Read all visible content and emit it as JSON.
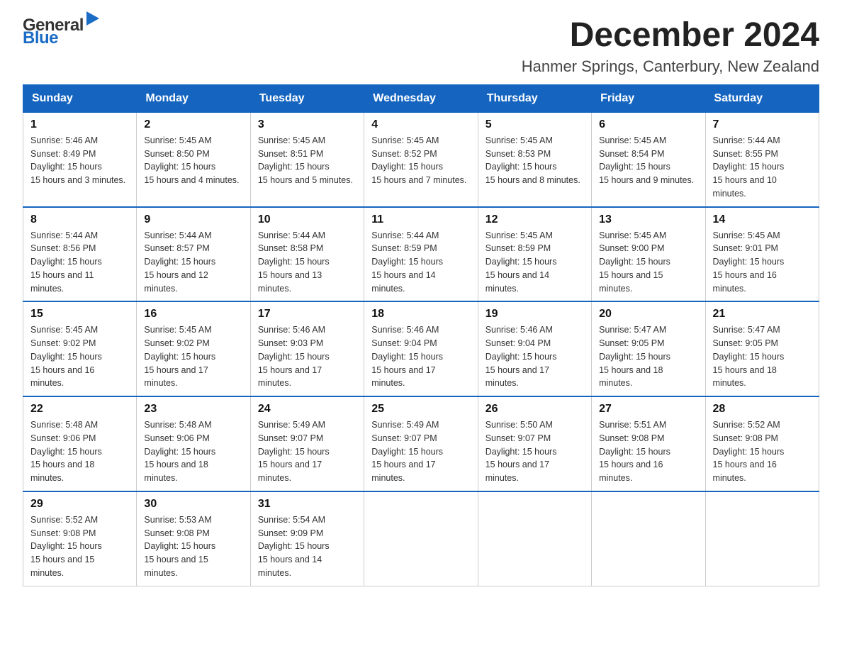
{
  "header": {
    "logo_general": "General",
    "logo_blue": "Blue",
    "title": "December 2024",
    "subtitle": "Hanmer Springs, Canterbury, New Zealand"
  },
  "calendar": {
    "days_of_week": [
      "Sunday",
      "Monday",
      "Tuesday",
      "Wednesday",
      "Thursday",
      "Friday",
      "Saturday"
    ],
    "weeks": [
      [
        {
          "day": "1",
          "sunrise": "5:46 AM",
          "sunset": "8:49 PM",
          "daylight": "15 hours and 3 minutes."
        },
        {
          "day": "2",
          "sunrise": "5:45 AM",
          "sunset": "8:50 PM",
          "daylight": "15 hours and 4 minutes."
        },
        {
          "day": "3",
          "sunrise": "5:45 AM",
          "sunset": "8:51 PM",
          "daylight": "15 hours and 5 minutes."
        },
        {
          "day": "4",
          "sunrise": "5:45 AM",
          "sunset": "8:52 PM",
          "daylight": "15 hours and 7 minutes."
        },
        {
          "day": "5",
          "sunrise": "5:45 AM",
          "sunset": "8:53 PM",
          "daylight": "15 hours and 8 minutes."
        },
        {
          "day": "6",
          "sunrise": "5:45 AM",
          "sunset": "8:54 PM",
          "daylight": "15 hours and 9 minutes."
        },
        {
          "day": "7",
          "sunrise": "5:44 AM",
          "sunset": "8:55 PM",
          "daylight": "15 hours and 10 minutes."
        }
      ],
      [
        {
          "day": "8",
          "sunrise": "5:44 AM",
          "sunset": "8:56 PM",
          "daylight": "15 hours and 11 minutes."
        },
        {
          "day": "9",
          "sunrise": "5:44 AM",
          "sunset": "8:57 PM",
          "daylight": "15 hours and 12 minutes."
        },
        {
          "day": "10",
          "sunrise": "5:44 AM",
          "sunset": "8:58 PM",
          "daylight": "15 hours and 13 minutes."
        },
        {
          "day": "11",
          "sunrise": "5:44 AM",
          "sunset": "8:59 PM",
          "daylight": "15 hours and 14 minutes."
        },
        {
          "day": "12",
          "sunrise": "5:45 AM",
          "sunset": "8:59 PM",
          "daylight": "15 hours and 14 minutes."
        },
        {
          "day": "13",
          "sunrise": "5:45 AM",
          "sunset": "9:00 PM",
          "daylight": "15 hours and 15 minutes."
        },
        {
          "day": "14",
          "sunrise": "5:45 AM",
          "sunset": "9:01 PM",
          "daylight": "15 hours and 16 minutes."
        }
      ],
      [
        {
          "day": "15",
          "sunrise": "5:45 AM",
          "sunset": "9:02 PM",
          "daylight": "15 hours and 16 minutes."
        },
        {
          "day": "16",
          "sunrise": "5:45 AM",
          "sunset": "9:02 PM",
          "daylight": "15 hours and 17 minutes."
        },
        {
          "day": "17",
          "sunrise": "5:46 AM",
          "sunset": "9:03 PM",
          "daylight": "15 hours and 17 minutes."
        },
        {
          "day": "18",
          "sunrise": "5:46 AM",
          "sunset": "9:04 PM",
          "daylight": "15 hours and 17 minutes."
        },
        {
          "day": "19",
          "sunrise": "5:46 AM",
          "sunset": "9:04 PM",
          "daylight": "15 hours and 17 minutes."
        },
        {
          "day": "20",
          "sunrise": "5:47 AM",
          "sunset": "9:05 PM",
          "daylight": "15 hours and 18 minutes."
        },
        {
          "day": "21",
          "sunrise": "5:47 AM",
          "sunset": "9:05 PM",
          "daylight": "15 hours and 18 minutes."
        }
      ],
      [
        {
          "day": "22",
          "sunrise": "5:48 AM",
          "sunset": "9:06 PM",
          "daylight": "15 hours and 18 minutes."
        },
        {
          "day": "23",
          "sunrise": "5:48 AM",
          "sunset": "9:06 PM",
          "daylight": "15 hours and 18 minutes."
        },
        {
          "day": "24",
          "sunrise": "5:49 AM",
          "sunset": "9:07 PM",
          "daylight": "15 hours and 17 minutes."
        },
        {
          "day": "25",
          "sunrise": "5:49 AM",
          "sunset": "9:07 PM",
          "daylight": "15 hours and 17 minutes."
        },
        {
          "day": "26",
          "sunrise": "5:50 AM",
          "sunset": "9:07 PM",
          "daylight": "15 hours and 17 minutes."
        },
        {
          "day": "27",
          "sunrise": "5:51 AM",
          "sunset": "9:08 PM",
          "daylight": "15 hours and 16 minutes."
        },
        {
          "day": "28",
          "sunrise": "5:52 AM",
          "sunset": "9:08 PM",
          "daylight": "15 hours and 16 minutes."
        }
      ],
      [
        {
          "day": "29",
          "sunrise": "5:52 AM",
          "sunset": "9:08 PM",
          "daylight": "15 hours and 15 minutes."
        },
        {
          "day": "30",
          "sunrise": "5:53 AM",
          "sunset": "9:08 PM",
          "daylight": "15 hours and 15 minutes."
        },
        {
          "day": "31",
          "sunrise": "5:54 AM",
          "sunset": "9:09 PM",
          "daylight": "15 hours and 14 minutes."
        },
        null,
        null,
        null,
        null
      ]
    ]
  }
}
